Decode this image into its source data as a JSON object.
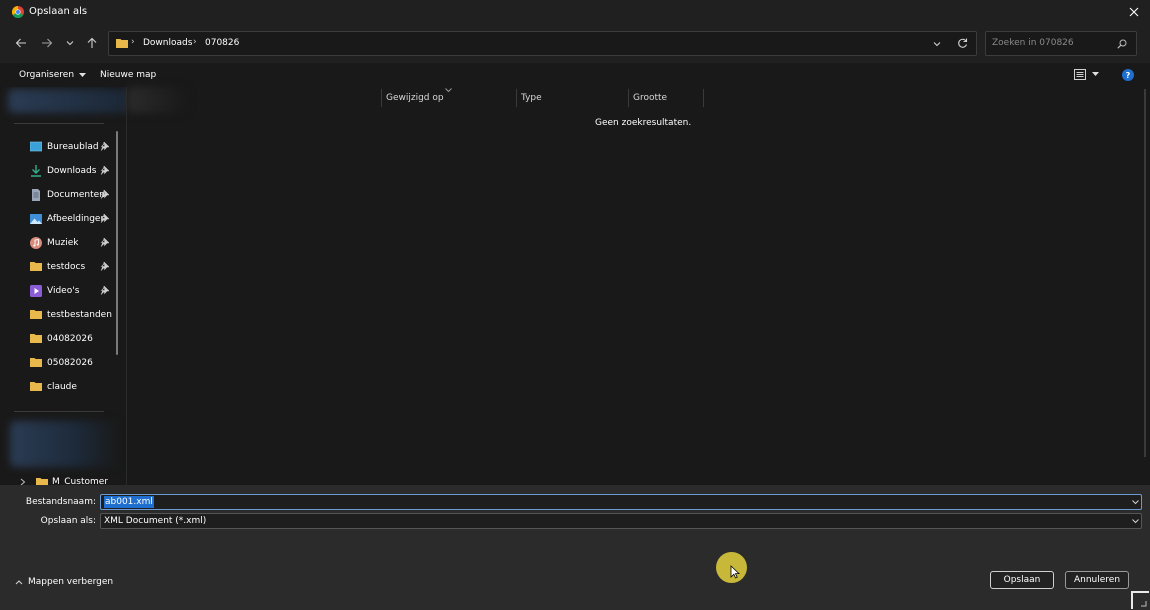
{
  "window": {
    "title": "Opslaan als",
    "close_icon": "close-icon"
  },
  "nav": {
    "back_icon": "arrow-left-icon",
    "forward_icon": "arrow-right-icon",
    "recent_icon": "chevron-down-icon",
    "up_icon": "arrow-up-icon",
    "breadcrumb": [
      "Downloads",
      "070826"
    ],
    "search_placeholder": "Zoeken in 070826"
  },
  "command_bar": {
    "organize_label": "Organiseren",
    "new_folder_label": "Nieuwe map"
  },
  "sidebar": {
    "items": [
      {
        "label": "Bureaublad",
        "icon": "desktop-icon",
        "pinned": true
      },
      {
        "label": "Downloads",
        "icon": "download-icon",
        "pinned": true
      },
      {
        "label": "Documenten",
        "icon": "document-icon",
        "pinned": true
      },
      {
        "label": "Afbeeldingen",
        "icon": "image-icon",
        "pinned": true
      },
      {
        "label": "Muziek",
        "icon": "music-icon",
        "pinned": true
      },
      {
        "label": "testdocs",
        "icon": "folder-icon",
        "pinned": true
      },
      {
        "label": "Video's",
        "icon": "video-icon",
        "pinned": true
      },
      {
        "label": "testbestanden",
        "icon": "folder-icon",
        "pinned": false
      },
      {
        "label": "04082026",
        "icon": "folder-icon",
        "pinned": false
      },
      {
        "label": "05082026",
        "icon": "folder-icon",
        "pinned": false
      },
      {
        "label": "claude",
        "icon": "folder-icon",
        "pinned": false
      }
    ],
    "tree_item": "M_Customer_"
  },
  "file_list": {
    "columns": [
      "Gewijzigd op",
      "Type",
      "Grootte"
    ],
    "empty_message": "Geen zoekresultaten."
  },
  "form": {
    "filename_label": "Bestandsnaam:",
    "filename_value": "ab001.xml",
    "savetype_label": "Opslaan als:",
    "savetype_value": "XML Document (*.xml)"
  },
  "footer": {
    "hide_folders_label": "Mappen verbergen",
    "save_label": "Opslaan",
    "cancel_label": "Annuleren"
  },
  "colors": {
    "accent": "#1e6fd0",
    "folder": "#e8b84a",
    "dialog_bg": "#191919",
    "footer_bg": "#2b2b2b"
  }
}
